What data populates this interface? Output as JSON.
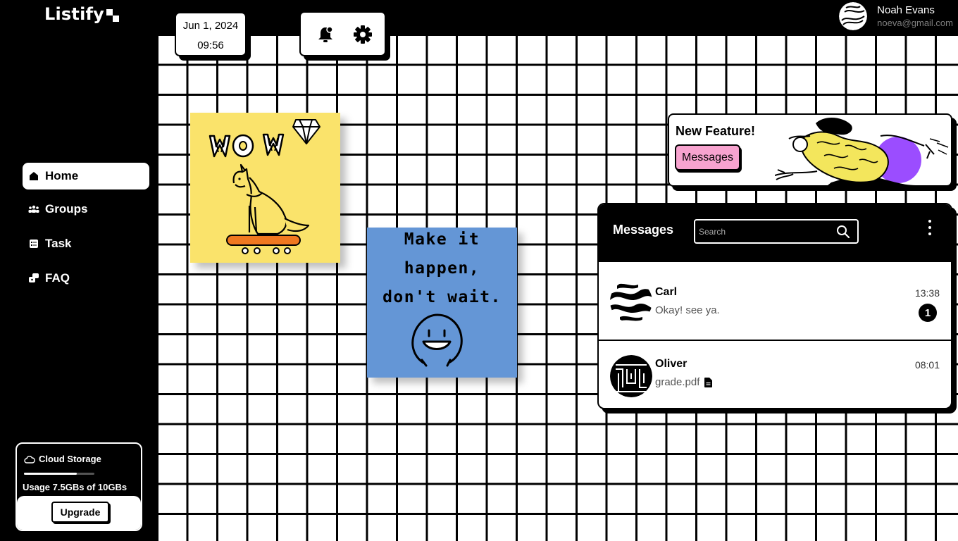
{
  "app": {
    "name": "Listify"
  },
  "sidebar": {
    "items": [
      {
        "label": "Home",
        "icon": "home-icon",
        "active": true
      },
      {
        "label": "Groups",
        "icon": "groups-icon"
      },
      {
        "label": "Task",
        "icon": "task-icon"
      },
      {
        "label": "FAQ",
        "icon": "faq-icon"
      }
    ],
    "storage": {
      "title": "Cloud Storage",
      "usage_text": "Usage 7.5GBs of 10GBs",
      "used_fraction": 0.75,
      "upgrade_label": "Upgrade"
    }
  },
  "header": {
    "date": "Jun 1, 2024",
    "time": "09:56",
    "icons": [
      "notification-bell-icon",
      "settings-gear-icon"
    ],
    "user": {
      "name": "Noah Evans",
      "email": "noeva@gmail.com"
    }
  },
  "notes": [
    {
      "color": "#fae36b",
      "lettering": "WOW",
      "drawing": "dog on skateboard with diamond"
    },
    {
      "color": "#6496d6",
      "lines": [
        "Make it",
        "happen,",
        "don't wait."
      ]
    }
  ],
  "feature": {
    "title": "New Feature!",
    "button_label": "Messages"
  },
  "messages": {
    "title": "Messages",
    "search_placeholder": "Search",
    "items": [
      {
        "name": "Carl",
        "preview": "Okay! see ya.",
        "time": "13:38",
        "unread": "1"
      },
      {
        "name": "Oliver",
        "preview": "grade.pdf",
        "time": "08:01",
        "attachment_icon": "file-icon"
      }
    ]
  },
  "colors": {
    "accent_pink": "#f7a3cf",
    "accent_purple": "#9b4dff",
    "note_yellow": "#fae36b",
    "note_blue": "#6496d6"
  }
}
